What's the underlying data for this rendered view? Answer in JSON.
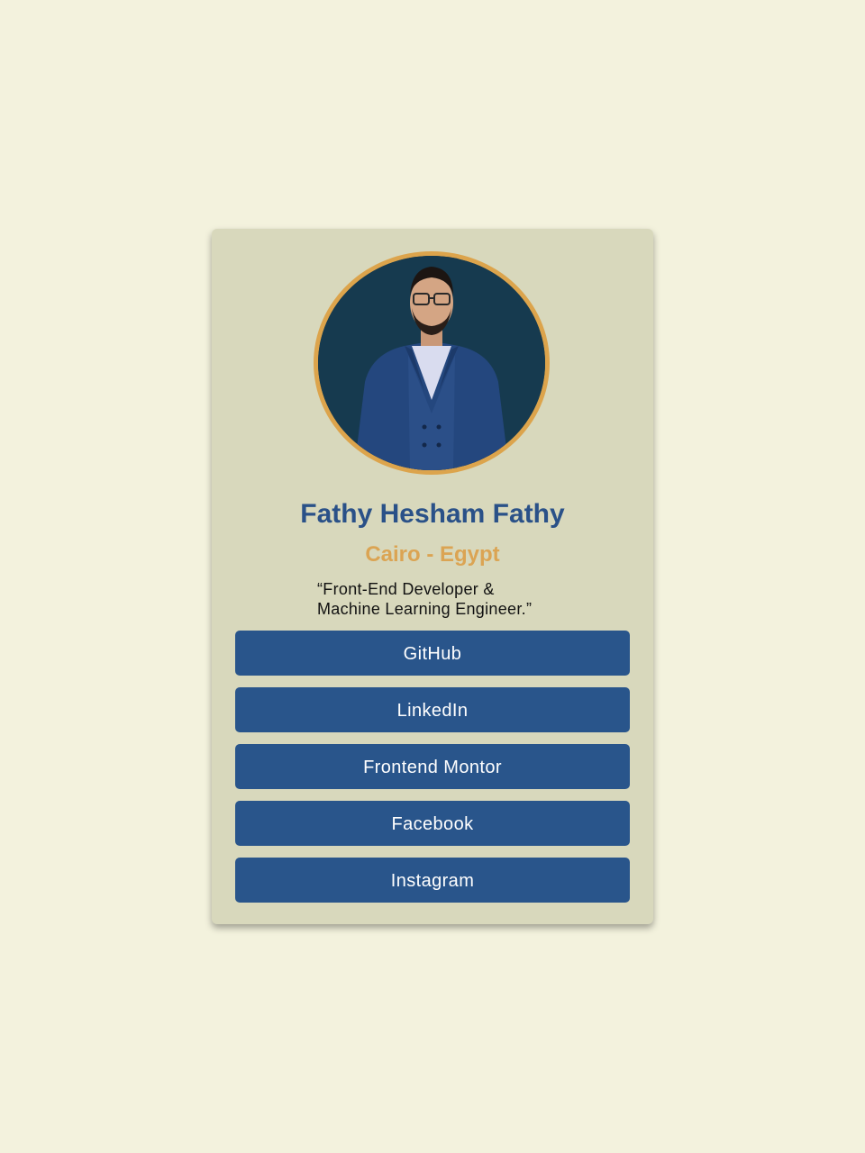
{
  "profile": {
    "name": "Fathy Hesham Fathy",
    "location": "Cairo - Egypt",
    "bio_line1": "“Front-End Developer &",
    "bio_line2": "Machine Learning Engineer.”",
    "avatar_icon": "avatar-photo"
  },
  "links": [
    {
      "label": "GitHub"
    },
    {
      "label": "LinkedIn"
    },
    {
      "label": "Frontend Montor"
    },
    {
      "label": "Facebook"
    },
    {
      "label": "Instagram"
    }
  ],
  "colors": {
    "page_background": "#f3f2dd",
    "card_background": "#d8d8bc",
    "primary_blue": "#29558b",
    "accent_gold": "#dca44c",
    "avatar_background": "#163a4f"
  }
}
